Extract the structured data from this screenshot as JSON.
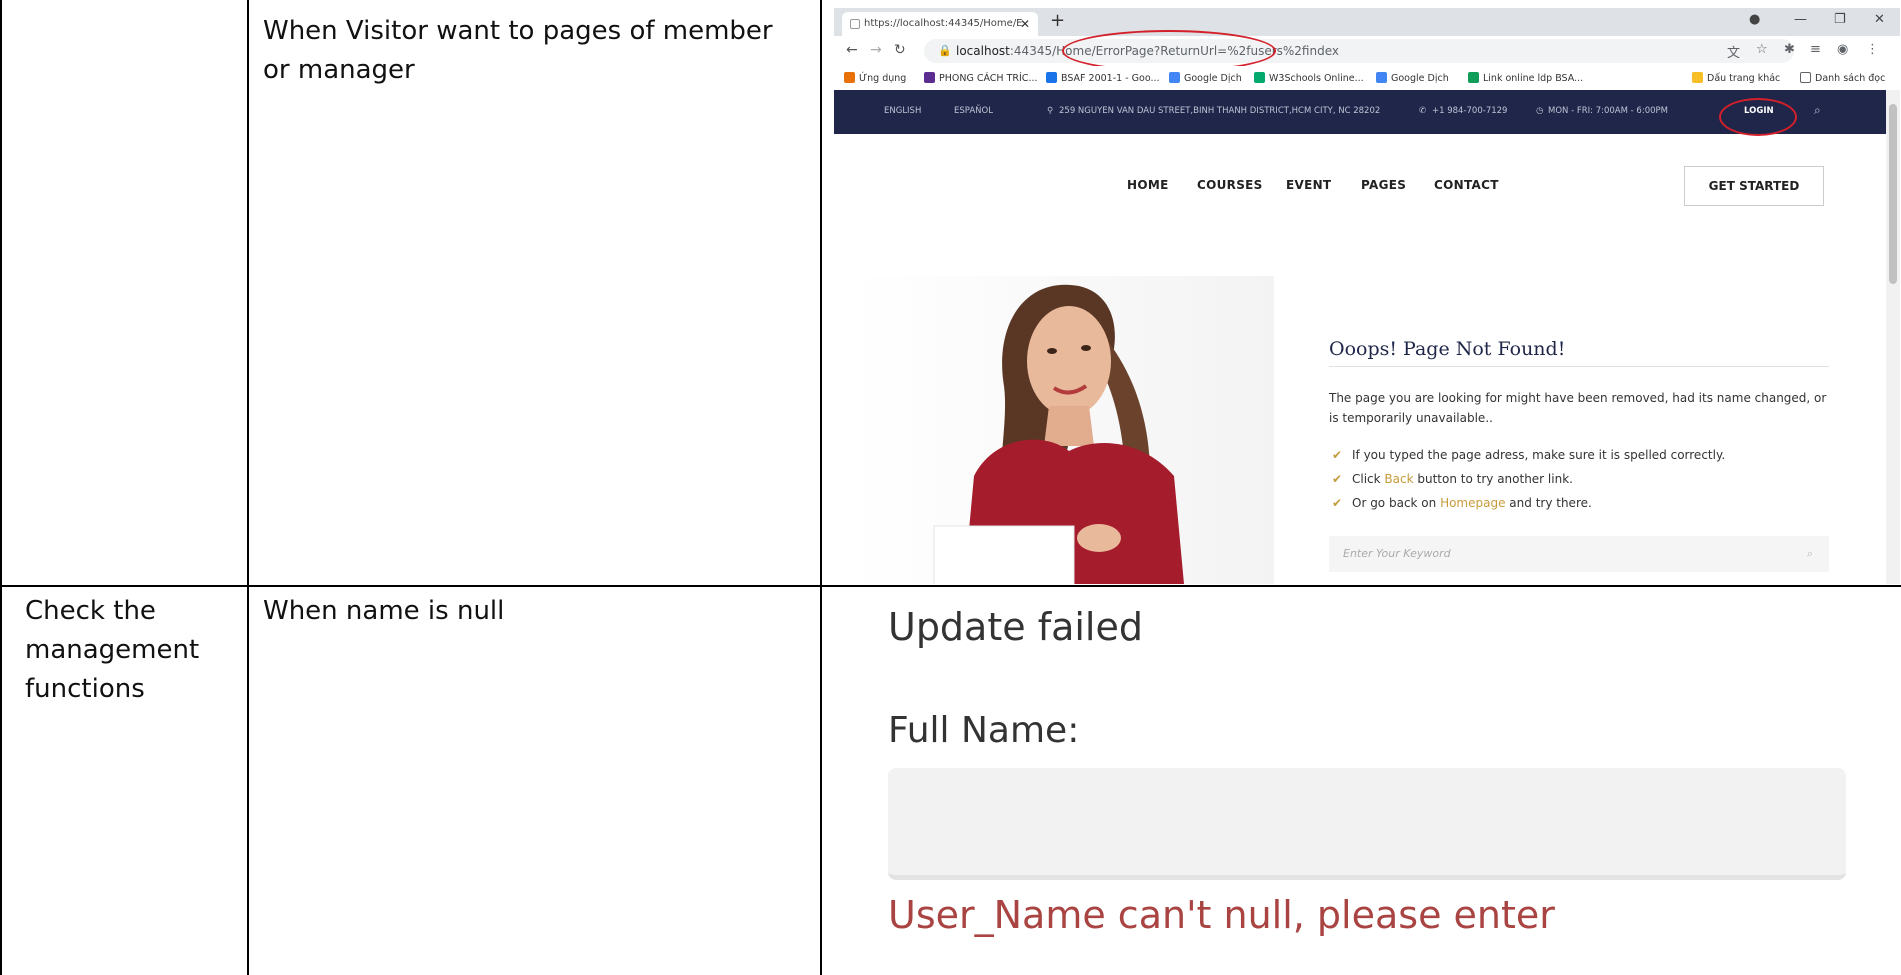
{
  "table": {
    "row1": {
      "col1": "",
      "col2": "When Visitor want to pages of member or manager"
    },
    "row2": {
      "col1": "Check the management functions",
      "col2": "When name is null"
    }
  },
  "browser": {
    "tab_title": "https://localhost:44345/Home/E",
    "new_tab": "+",
    "url_host": "localhost",
    "url_rest": ":44345/Home/ErrorPage?ReturnUrl=%2fusers%2findex",
    "bookmarks": [
      {
        "label": "Ứng dụng",
        "color": "#e8710a"
      },
      {
        "label": "PHONG CÁCH TRÍC...",
        "color": "#5c2d91"
      },
      {
        "label": "BSAF 2001-1 - Goo...",
        "color": "#1a73e8"
      },
      {
        "label": "Google Dịch",
        "color": "#4285f4"
      },
      {
        "label": "W3Schools Online...",
        "color": "#04aa6d"
      },
      {
        "label": "Google Dịch",
        "color": "#4285f4"
      },
      {
        "label": "Link online ldp BSA...",
        "color": "#0f9d58"
      },
      {
        "label": "Dấu trang khác",
        "color": "#f6bf26"
      },
      {
        "label": "Danh sách đọc",
        "color": "#5f6368"
      }
    ]
  },
  "site": {
    "lang_en": "ENGLISH",
    "lang_es": "ESPAÑOL",
    "address": "259 NGUYEN VAN DAU STREET,BINH THANH DISTRICT,HCM CITY, NC 28202",
    "phone": "+1 984-700-7129",
    "hours": "MON - FRI: 7:00AM - 6:00PM",
    "login": "LOGIN",
    "menu": [
      "HOME",
      "COURSES",
      "EVENT",
      "PAGES",
      "CONTACT"
    ],
    "get_started": "GET STARTED",
    "error_title": "Ooops! Page Not Found!",
    "error_desc": "The page you are looking for might have been removed, had its name changed, or is temporarily unavailable..",
    "tips": {
      "t1": "If you typed the page adress, make sure it is spelled correctly.",
      "t2_pre": "Click ",
      "t2_link": "Back",
      "t2_post": " button to try another link.",
      "t3_pre": "Or go back on ",
      "t3_link": "Homepage",
      "t3_post": " and try there."
    },
    "search_placeholder": "Enter Your Keyword"
  },
  "update_form": {
    "title": "Update failed",
    "label": "Full Name:",
    "value": "",
    "error": "User_Name can't null, please enter"
  },
  "colors": {
    "nav_bg": "#1f2649",
    "accent": "#c69b3c",
    "error": "#a94442",
    "annotation": "#d4202a"
  }
}
